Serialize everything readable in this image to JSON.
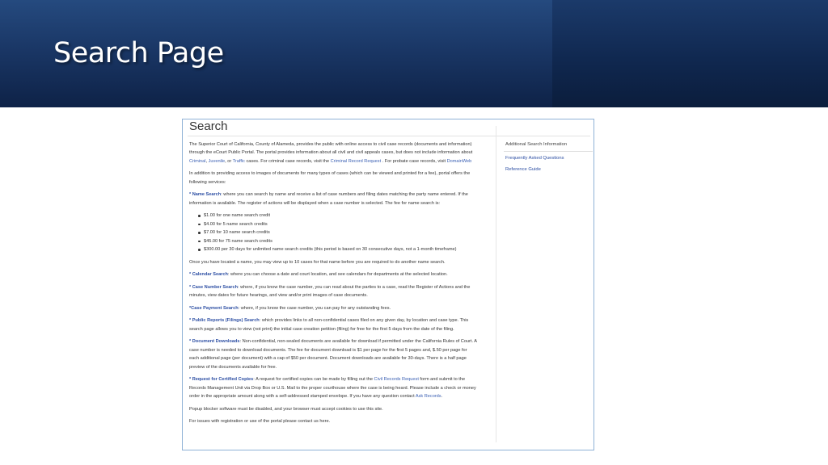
{
  "slide": {
    "title": "Search Page"
  },
  "page": {
    "title": "Search",
    "intro": {
      "t1": "The Superior Court of California, County of Alameda, provides the public with online access to civil case records (documents and information) through the eCourt Public Portal. The portal provides information about all civil and civil appeals cases, but does not include information about ",
      "criminal": "Criminal",
      "comma": ", ",
      "juvenile": "Juvenile",
      "or": ", or ",
      "traffic": "Traffic",
      "t2": " cases.  For criminal case records, visit the ",
      "criminal_request": "Criminal Record Request",
      "t3": " . For probate case records, visit ",
      "domainweb": "DomainWeb"
    },
    "services_intro": "In addition to providing access to images of documents for many types of cases (which can be viewed and printed for a fee), portal offers the following services:",
    "name_search": {
      "label": "* Name Search",
      "text": ": where you can search by name and receive a list of case numbers and filing dates matching the party name entered. If the information is available. The register of actions will be displayed when a case number is selected. The fee for name search is:"
    },
    "fees": [
      "$1.00 for one name search credit",
      "$4.00 for 5 name search credits",
      "$7.00 for 10 name search credits",
      "$45.00 for 75 name search credits",
      "$300.00 per 30 days for unlimited name search credits (this period is based on 30 consecutive days, not a 1-month timeframe)"
    ],
    "located_note": "Once you have located a name, you may view up to 10 cases for that name before you are required to do another name search.",
    "calendar_search": {
      "label": "* Calendar Search",
      "text": ": where you can choose a date and court location, and see calendars for departments at the selected location."
    },
    "case_number_search": {
      "label": "* Case Number Search",
      "text": ": where, if you know the case number, you can read about the parties to a case, read the Register of Actions and the minutes, view dates for future hearings, and view and/or print images of case documents."
    },
    "case_payment_search": {
      "label": "*Case Payment Search",
      "text": ": where, if you know the case number, you can pay for any outstanding fees."
    },
    "public_reports": {
      "label": "* Public Reports (Filings) Search",
      "text": ": which provides links to all non-confidential cases filed on any given day, by location and case type. This search page allows you to view (not print) the initial case creation petition (filing) for free for the first 5 days from the date of the filing."
    },
    "document_downloads": {
      "label": "* Document Downloads",
      "text": ": Non-confidential, non-sealed documents are available for download if permitted under the California Rules of Court. A case number is needed to download documents. The fee for document download is $1 per page for the first 5 pages and, $.50 per page for each additional page (per document) with a cap of $50 per document. Document downloads are available for 30-days. There is a half page preview of the documents available for free."
    },
    "certified_copies": {
      "label": "* Request for Certified Copies",
      "t1": ": A request for certified copies can be made by filling out the ",
      "civil_records_request": "Civil Records Request",
      "t2": " form and submit to the Records Management Unit via Drop Box or U.S. Mail to the proper courthouse where the case is being heard. Please include a check or money order in the appropriate amount along with a self-addressed stamped envelope. If you have any question contact ",
      "ask_records": "Ask Records",
      "t3": "."
    },
    "popup_note": "Popup blocker software must be disabled, and your browser must accept cookies to use this site.",
    "issues_note": "For issues with registration or use of the portal please contact us here.",
    "sidebar": {
      "heading": "Additional Search Information",
      "links": [
        "Frequently Asked Questions",
        "Reference Guide"
      ]
    }
  },
  "colors": {
    "banner_dark": "#0e2247",
    "banner_light": "#254a7f",
    "link": "#2c4ea3",
    "frame_border": "#8fb1d6"
  }
}
